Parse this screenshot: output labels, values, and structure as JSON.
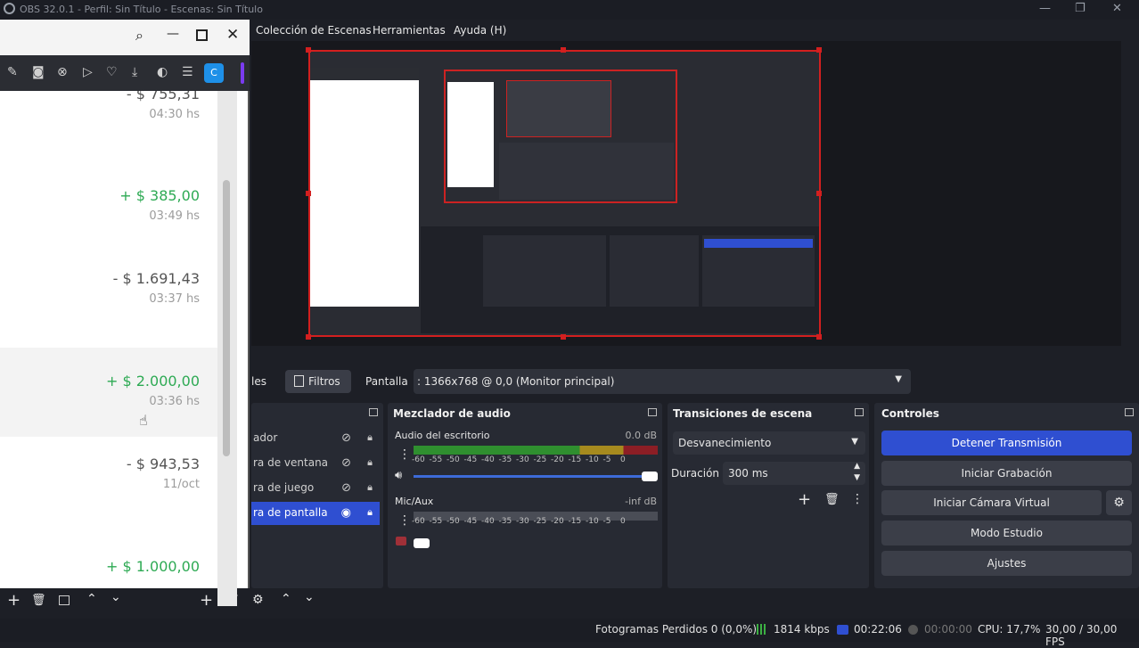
{
  "titlebar": {
    "title": "OBS 32.0.1 - Perfil: Sin Título - Escenas: Sin Título"
  },
  "menu": {
    "items": [
      "Colección de Escenas",
      "Herramientas",
      "Ayuda (H)"
    ]
  },
  "app": {
    "transactions": [
      {
        "amount": "- $ 755,31",
        "time": "04:30 hs",
        "type": "neg"
      },
      {
        "amount": "+ $ 385,00",
        "time": "03:49 hs",
        "type": "pos"
      },
      {
        "amount": "- $ 1.691,43",
        "time": "03:37 hs",
        "type": "neg"
      },
      {
        "amount": "+ $ 2.000,00",
        "time": "03:36 hs",
        "type": "pos"
      },
      {
        "amount": "- $ 943,53",
        "time": "11/oct",
        "type": "neg"
      },
      {
        "amount": "+ $ 1.000,00",
        "time": "",
        "type": "pos"
      }
    ],
    "avatar_letter": "C"
  },
  "filterbar": {
    "properties_partial": "les",
    "filters_label": "Filtros",
    "source_label": "Pantalla",
    "display_value": ": 1366x768 @ 0,0 (Monitor principal)"
  },
  "sources": {
    "items": [
      {
        "label": "ador",
        "active": false
      },
      {
        "label": "ra de ventana",
        "active": false
      },
      {
        "label": "ra de juego",
        "active": false
      },
      {
        "label": "ra de pantalla",
        "active": true
      }
    ]
  },
  "mixer": {
    "title": "Mezclador de audio",
    "channels": [
      {
        "name": "Audio del escritorio",
        "level": "0.0 dB"
      },
      {
        "name": "Mic/Aux",
        "level": "-inf dB"
      }
    ],
    "ticks": [
      "-60",
      "-55",
      "-50",
      "-45",
      "-40",
      "-35",
      "-30",
      "-25",
      "-20",
      "-15",
      "-10",
      "-5",
      "0"
    ]
  },
  "transitions": {
    "title": "Transiciones de escena",
    "selected": "Desvanecimiento",
    "duration_label": "Duración",
    "duration_value": "300 ms"
  },
  "controls": {
    "title": "Controles",
    "buttons": [
      "Detener Transmisión",
      "Iniciar Grabación",
      "Iniciar Cámara Virtual",
      "Modo Estudio",
      "Ajustes"
    ]
  },
  "status": {
    "dropped": "Fotogramas Perdidos 0 (0,0%)",
    "bitrate": "1814 kbps",
    "stream_time": "00:22:06",
    "rec_time": "00:00:00",
    "cpu": "CPU: 17,7%",
    "fps": "30,00 / 30,00 FPS"
  },
  "colors": {
    "accent": "#2f4fd1",
    "selection": "#d31f1f",
    "positive": "#2eaa54"
  }
}
